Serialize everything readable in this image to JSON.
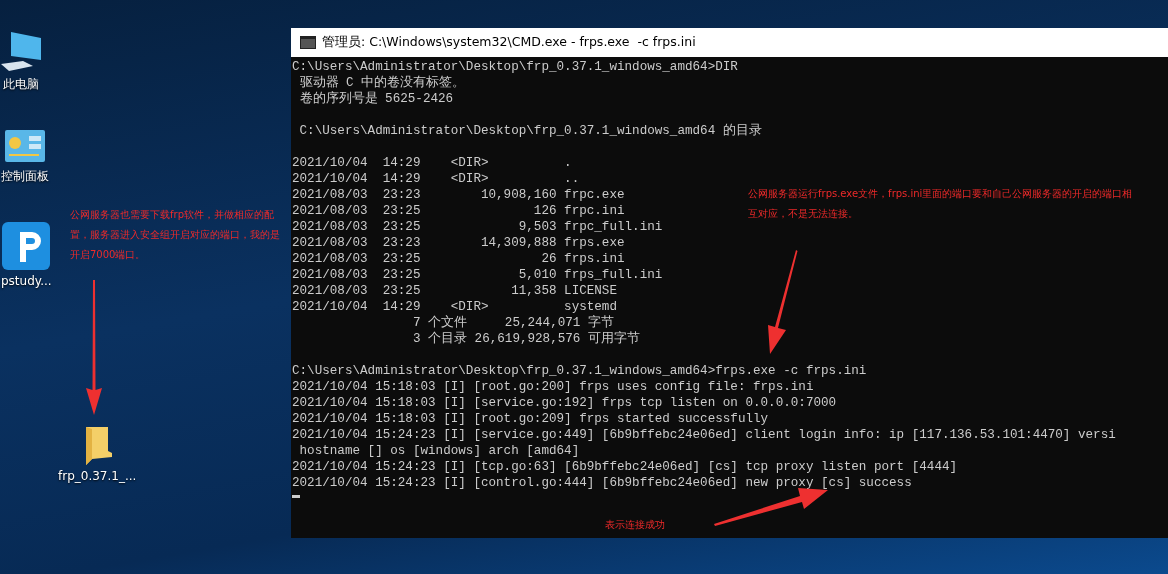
{
  "desktop": {
    "icons": [
      {
        "kind": "computer",
        "label": "此电脑"
      },
      {
        "kind": "control-panel",
        "label": "控制面板"
      },
      {
        "kind": "app",
        "label": "pstudy..."
      },
      {
        "kind": "folder",
        "label": "frp_0.37.1_..."
      }
    ],
    "notes": [
      {
        "text": "公网服务器也需要下载frp软件，并做相应的配置，服务器进入安全组开启对应的端口，我的是开启7000端口。"
      },
      {
        "text": "公网服务器运行frps.exe文件，frps.ini里面的端口要和自己公网服务器的开启的端口相互对应，不是无法连接。"
      },
      {
        "text": "表示连接成功"
      }
    ]
  },
  "window": {
    "title": "管理员: C:\\Windows\\system32\\CMD.exe - frps.exe  -c frps.ini",
    "blocks": [
      [
        "C:\\Users\\Administrator\\Desktop\\frp_0.37.1_windows_amd64>DIR",
        " 驱动器 C 中的卷没有标签。",
        " 卷的序列号是 5625-2426"
      ],
      [
        " C:\\Users\\Administrator\\Desktop\\frp_0.37.1_windows_amd64 的目录"
      ],
      [
        "2021/10/04  14:29    <DIR>          .",
        "2021/10/04  14:29    <DIR>          ..",
        "2021/08/03  23:23        10,908,160 frpc.exe",
        "2021/08/03  23:25               126 frpc.ini",
        "2021/08/03  23:25             9,503 frpc_full.ini",
        "2021/08/03  23:23        14,309,888 frps.exe",
        "2021/08/03  23:25                26 frps.ini",
        "2021/08/03  23:25             5,010 frps_full.ini",
        "2021/08/03  23:25            11,358 LICENSE",
        "2021/10/04  14:29    <DIR>          systemd",
        "                7 个文件     25,244,071 字节",
        "                3 个目录 26,619,928,576 可用字节"
      ],
      [
        "C:\\Users\\Administrator\\Desktop\\frp_0.37.1_windows_amd64>frps.exe -c frps.ini",
        "2021/10/04 15:18:03 [I] [root.go:200] frps uses config file: frps.ini",
        "2021/10/04 15:18:03 [I] [service.go:192] frps tcp listen on 0.0.0.0:7000",
        "2021/10/04 15:18:03 [I] [root.go:209] frps started successfully",
        "2021/10/04 15:24:23 [I] [service.go:449] [6b9bffebc24e06ed] client login info: ip [117.136.53.101:4470] versi",
        " hostname [] os [windows] arch [amd64]",
        "2021/10/04 15:24:23 [I] [tcp.go:63] [6b9bffebc24e06ed] [cs] tcp proxy listen port [4444]",
        "2021/10/04 15:24:23 [I] [control.go:444] [6b9bffebc24e06ed] new proxy [cs] success"
      ]
    ]
  }
}
